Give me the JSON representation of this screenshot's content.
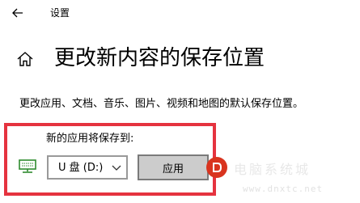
{
  "window": {
    "title": "设置",
    "back_icon": "arrow-left-icon"
  },
  "page": {
    "home_icon": "home-icon",
    "title": "更改新内容的保存位置",
    "description": "更改应用、文档、音乐、图片、视频和地图的默认保存位置。"
  },
  "apps_section": {
    "label": "新的应用将保存到:",
    "device_icon": "monitor-icon",
    "drive_select": {
      "selected": "U 盘 (D:)"
    },
    "apply_label": "应用",
    "highlight_color": "#e5333f"
  },
  "watermark": {
    "text": "电脑系统城",
    "url": "www.dnxtc.net"
  }
}
